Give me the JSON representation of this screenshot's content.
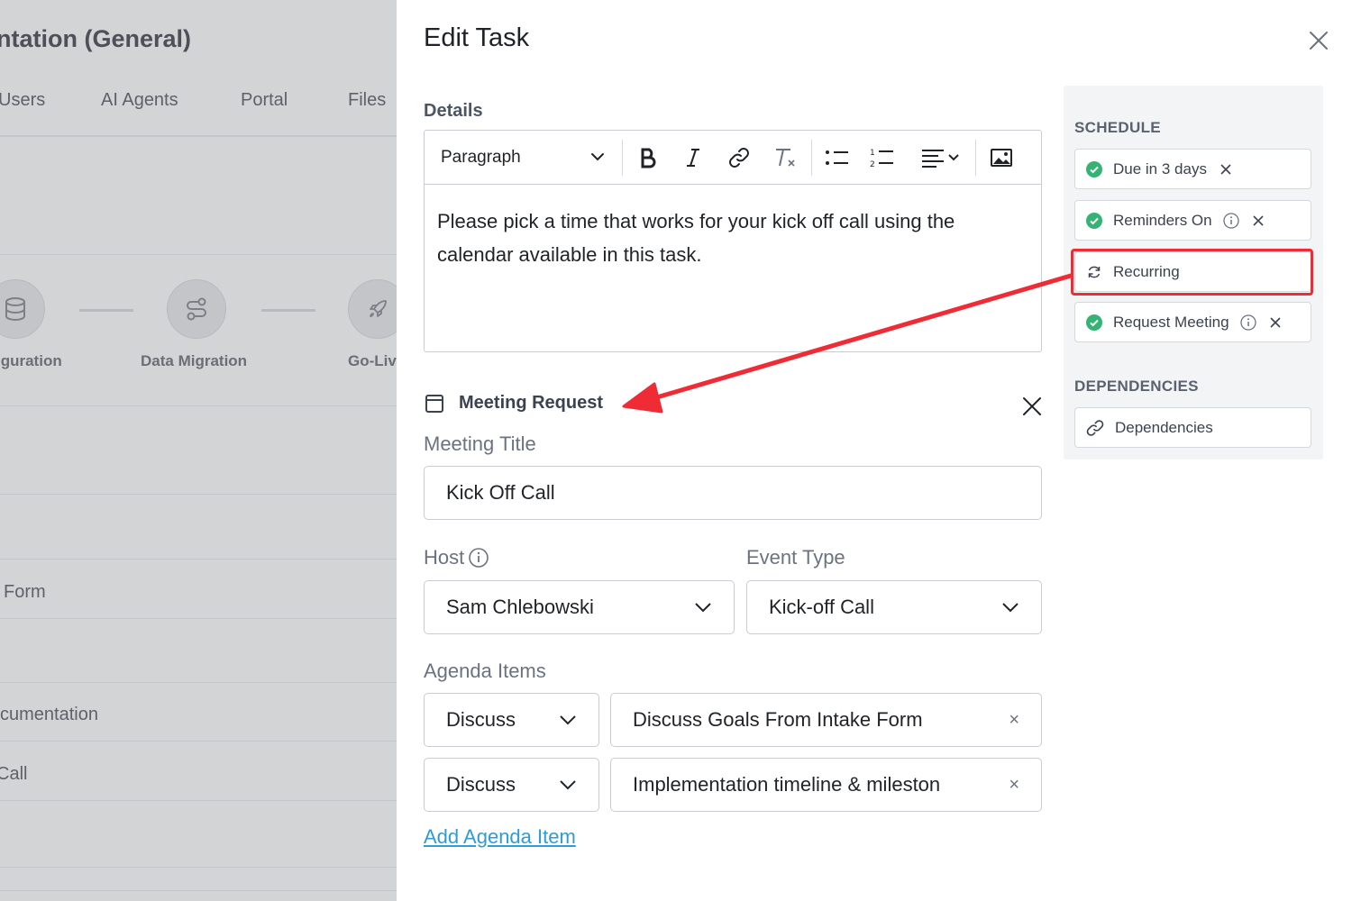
{
  "background": {
    "title": "ntation (General)",
    "tabs": [
      "Users",
      "AI Agents",
      "Portal",
      "Files"
    ],
    "steps": [
      "iguration",
      "Data Migration",
      "Go-Liv"
    ],
    "rows": [
      "Form",
      "cumentation",
      "Call"
    ]
  },
  "modal": {
    "title": "Edit Task",
    "details_label": "Details",
    "editor": {
      "paragraph_select": "Paragraph",
      "content": "Please pick a time that works for your kick off call using the calendar available in this task."
    },
    "meeting_request": {
      "heading": "Meeting Request",
      "meeting_title_label": "Meeting Title",
      "meeting_title_value": "Kick Off Call",
      "host_label": "Host",
      "host_value": "Sam Chlebowski",
      "event_type_label": "Event Type",
      "event_type_value": "Kick-off Call",
      "agenda_label": "Agenda Items",
      "agenda_items": [
        {
          "type": "Discuss",
          "text": "Discuss Goals From Intake Form"
        },
        {
          "type": "Discuss",
          "text": "Implementation timeline & miles­ton"
        }
      ],
      "add_agenda": "Add Agenda Item"
    },
    "sidebar": {
      "schedule_heading": "SCHEDULE",
      "chips": [
        "Due in 3 days",
        "Reminders On",
        "Recurring",
        "Request Meeting"
      ],
      "dependencies_heading": "DEPENDENCIES",
      "dependencies_chip": "Dependencies"
    }
  },
  "colors": {
    "accent_link": "#2d9cdb",
    "check_green": "#34b374",
    "highlight_red": "#ef2b36",
    "overlay_gray": "#d3d4d6"
  }
}
